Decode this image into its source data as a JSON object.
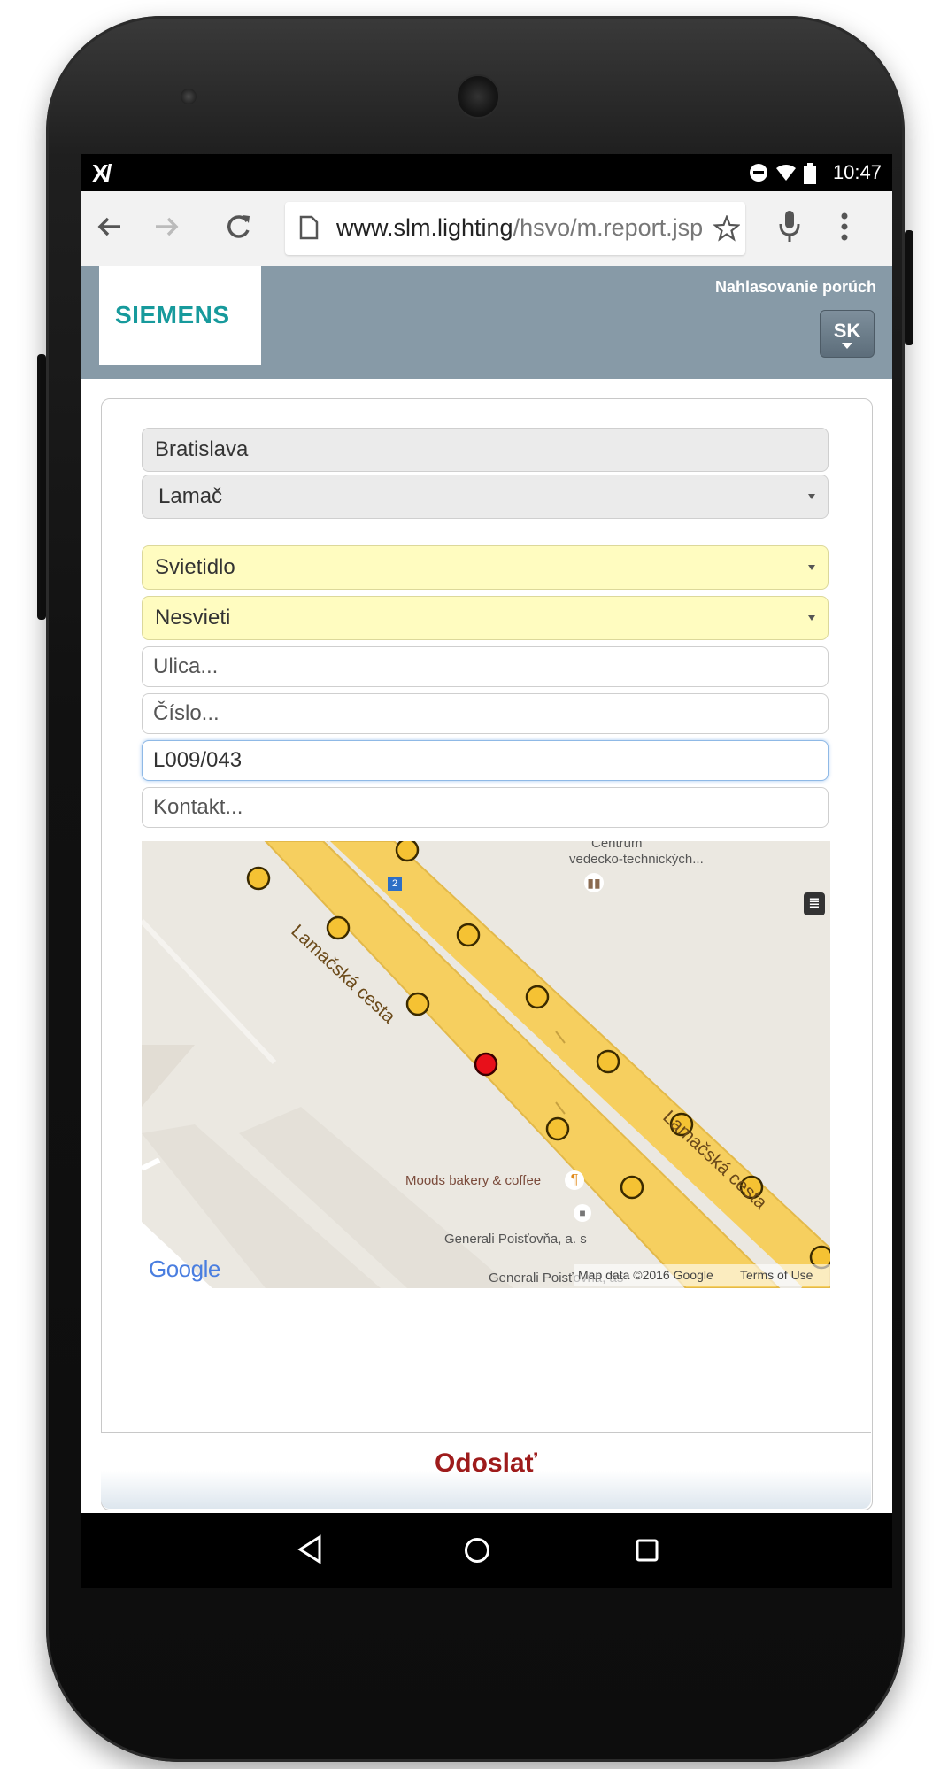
{
  "status_bar": {
    "time": "10:47"
  },
  "browser": {
    "url_host": "www.slm.lighting",
    "url_path": "/hsvo/m.report.jsp"
  },
  "header": {
    "brand": "SIEMENS",
    "link": "Nahlasovanie porúch",
    "language": "SK"
  },
  "form": {
    "city": "Bratislava",
    "district": "Lamač",
    "object_type": "Svietidlo",
    "fault_type": "Nesvieti",
    "street_placeholder": "Ulica...",
    "number_placeholder": "Číslo...",
    "lamp_id": "L009/043",
    "contact_placeholder": "Kontakt..."
  },
  "map": {
    "road_label_1": "Lamačská cesta",
    "road_label_2": "Lamačská cesta",
    "poi_centrum_1": "Centrum",
    "poi_centrum_2": "vedecko-technických...",
    "poi_bakery": "Moods bakery & coffee",
    "poi_generali": "Generali Poisťovňa, a. s",
    "poi_generali_2": "Generali Poisťovňa, as",
    "bus_stop": "2",
    "google": "Google",
    "attribution": "Map data ©2016 Google",
    "terms": "Terms of Use",
    "colors": {
      "lamp": "#f5c233",
      "selected_lamp": "#e8101a",
      "road": "#f8d46c"
    }
  },
  "submit_label": "Odoslať"
}
